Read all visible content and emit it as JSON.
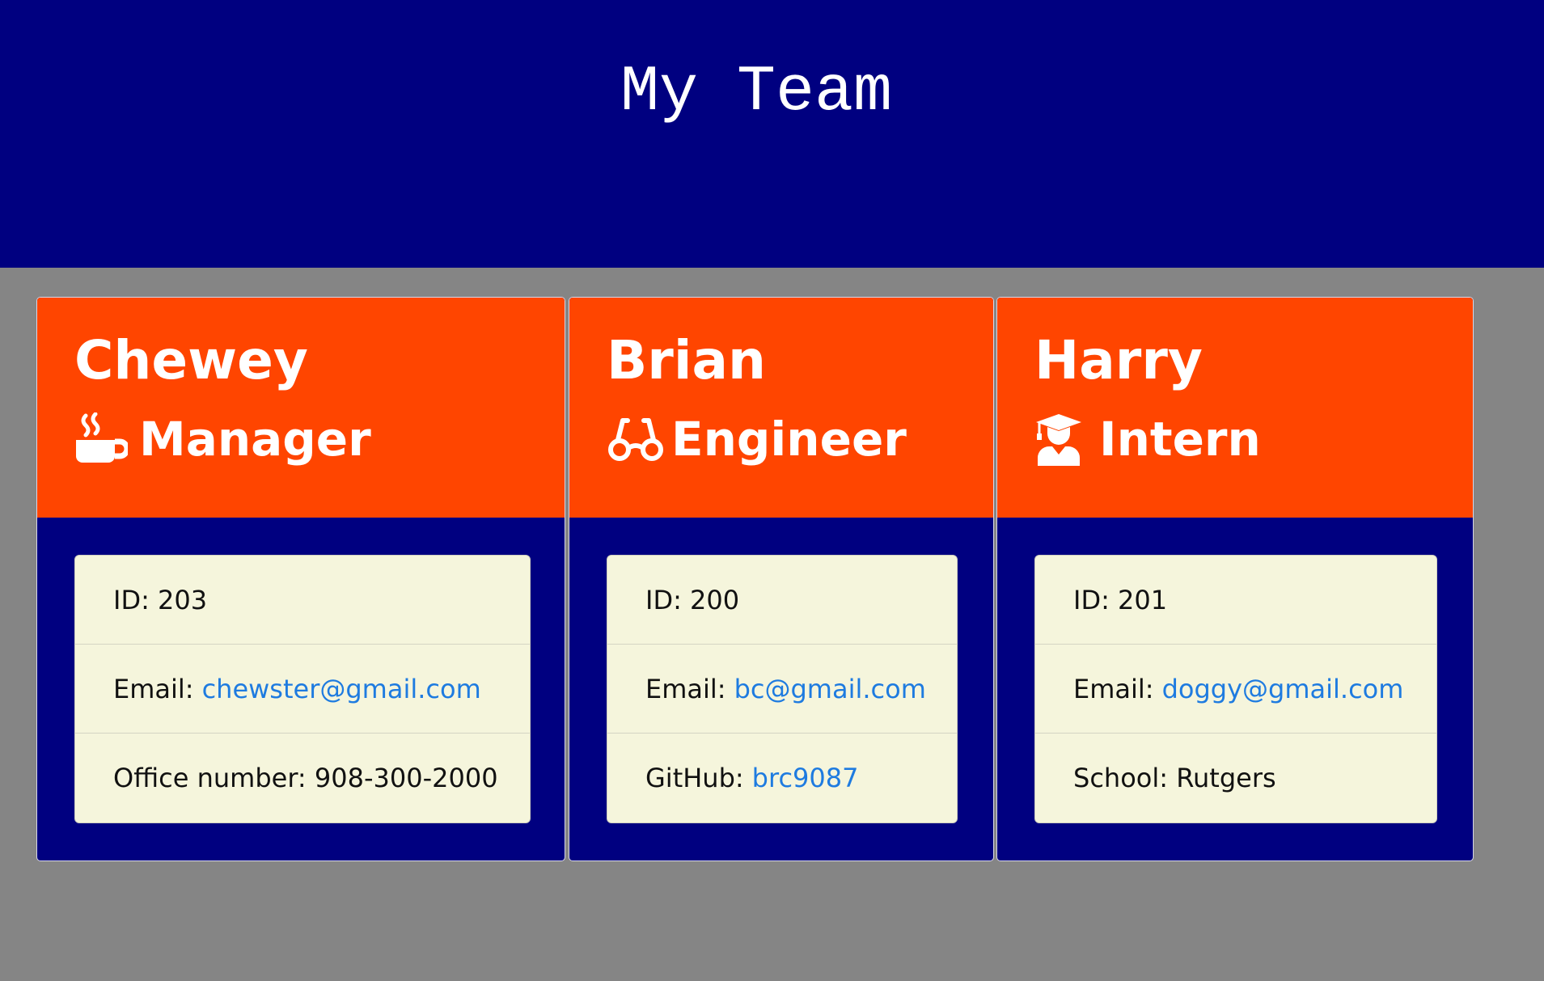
{
  "header": {
    "title": "My Team"
  },
  "colors": {
    "header_bg": "#000080",
    "page_bg": "#858585",
    "card_header_bg": "#ff4500",
    "card_body_bg": "#000080",
    "list_bg": "#f5f5dc",
    "link": "#1e7be0"
  },
  "team": [
    {
      "name": "Chewey",
      "role": "Manager",
      "icon": "mug-icon",
      "id_line": "ID: 203",
      "email_label": "Email:",
      "email": "chewster@gmail.com",
      "extra_label": "Office number: 908-300-2000",
      "extra_link": ""
    },
    {
      "name": "Brian",
      "role": "Engineer",
      "icon": "glasses-icon",
      "id_line": "ID: 200",
      "email_label": "Email:",
      "email": "bc@gmail.com",
      "extra_label": "GitHub:",
      "extra_link": "brc9087"
    },
    {
      "name": "Harry",
      "role": "Intern",
      "icon": "graduate-icon",
      "id_line": "ID: 201",
      "email_label": "Email:",
      "email": "doggy@gmail.com",
      "extra_label": "School: Rutgers",
      "extra_link": ""
    }
  ]
}
